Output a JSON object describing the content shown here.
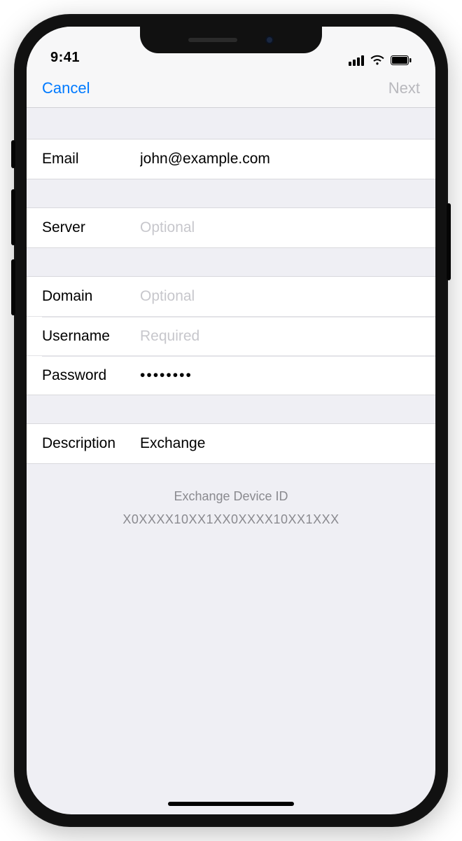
{
  "status": {
    "time": "9:41"
  },
  "nav": {
    "cancel": "Cancel",
    "next": "Next"
  },
  "fields": {
    "email": {
      "label": "Email",
      "value": "john@example.com",
      "placeholder": ""
    },
    "server": {
      "label": "Server",
      "value": "",
      "placeholder": "Optional"
    },
    "domain": {
      "label": "Domain",
      "value": "",
      "placeholder": "Optional"
    },
    "username": {
      "label": "Username",
      "value": "",
      "placeholder": "Required"
    },
    "password": {
      "label": "Password",
      "value": "••••••••",
      "placeholder": ""
    },
    "description": {
      "label": "Description",
      "value": "Exchange",
      "placeholder": ""
    }
  },
  "footer": {
    "deviceIdTitle": "Exchange Device ID",
    "deviceIdValue": "X0XXXX10XX1XX0XXXX10XX1XXX"
  }
}
